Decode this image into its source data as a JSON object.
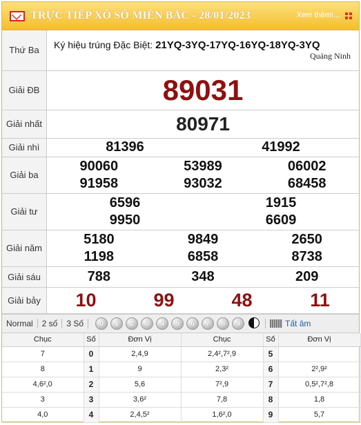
{
  "header": {
    "title": "TRỰC TIẾP XỔ SỐ MIỀN BẮC - 28/01/2023",
    "more": "Xem thêm!...",
    "mail_icon": "mail-icon",
    "grid_icon": "grid-icon"
  },
  "thuba": {
    "label": "Thứ Ba",
    "kh_label": "Ký hiệu trúng Đặc Biệt:",
    "kh_value": "21YQ-3YQ-17YQ-16YQ-18YQ-3YQ",
    "place": "Quảng Ninh"
  },
  "giai": {
    "db": {
      "label": "Giải ĐB",
      "nums": [
        "89031"
      ]
    },
    "nhat": {
      "label": "Giải nhất",
      "nums": [
        "80971"
      ]
    },
    "nhi": {
      "label": "Giải nhì",
      "nums": [
        "81396",
        "41992"
      ]
    },
    "ba": {
      "label": "Giải ba",
      "nums": [
        "90060",
        "53989",
        "06002",
        "91958",
        "93032",
        "68458"
      ]
    },
    "tu": {
      "label": "Giải tư",
      "nums": [
        "6596",
        "1915",
        "9950",
        "6609"
      ]
    },
    "nam": {
      "label": "Giải năm",
      "nums": [
        "5180",
        "9849",
        "2650",
        "1198",
        "6858",
        "8738"
      ]
    },
    "sau": {
      "label": "Giải sáu",
      "nums": [
        "788",
        "348",
        "209"
      ]
    },
    "bay": {
      "label": "Giải bảy",
      "nums": [
        "10",
        "99",
        "48",
        "11"
      ]
    }
  },
  "toolbar": {
    "options": [
      "Normal",
      "2 số",
      "3 Số"
    ],
    "digits": [
      "0",
      "1",
      "2",
      "3",
      "4",
      "5",
      "6",
      "7",
      "8",
      "9"
    ],
    "tatam": "Tất âm"
  },
  "loto": {
    "headers": [
      "Chục",
      "Số",
      "Đơn Vị",
      "Chục",
      "Số",
      "Đơn Vị"
    ],
    "rows": [
      {
        "c1": "7",
        "s1": "0",
        "d1": "2,4,9",
        "c2": "2,4²,7²,9",
        "s2": "5",
        "d2": ""
      },
      {
        "c1": "8",
        "s1": "1",
        "d1": "9",
        "c2": "2,3²",
        "s2": "6",
        "d2": "2²,9²"
      },
      {
        "c1": "4,6²,0",
        "s1": "2",
        "d1": "5,6",
        "c2": "7²,9",
        "s2": "7",
        "d2": "0,5²,7²,8"
      },
      {
        "c1": "3",
        "s1": "3",
        "d1": "3,6²",
        "c2": "7,8",
        "s2": "8",
        "d2": "1,8"
      },
      {
        "c1": "4,0",
        "s1": "4",
        "d1": "2,4,5²",
        "c2": "1,6²,0",
        "s2": "9",
        "d2": "5,7"
      }
    ]
  }
}
